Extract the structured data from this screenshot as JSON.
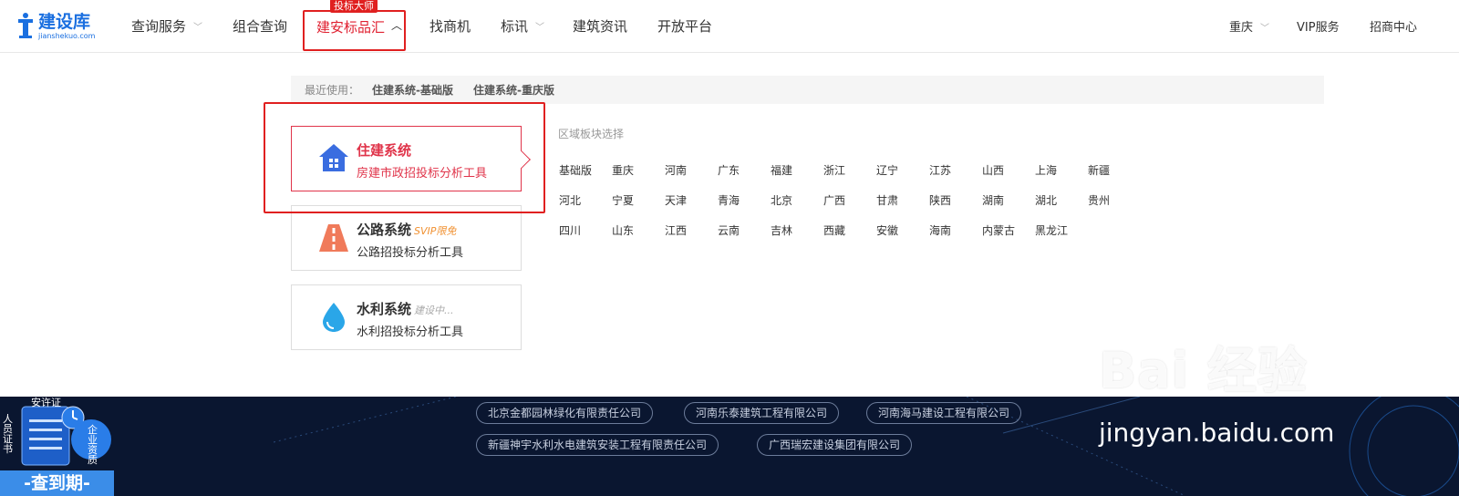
{
  "nav": {
    "logo_name": "建设库",
    "logo_sub": "jianshekuo.com",
    "items": [
      "查询服务",
      "组合查询",
      "建安标品汇",
      "找商机",
      "标讯",
      "建筑资讯",
      "开放平台"
    ],
    "badge": "投标大师",
    "right": [
      "重庆",
      "VIP服务",
      "招商中心"
    ]
  },
  "recent": {
    "label": "最近使用：",
    "items": [
      "住建系统-基础版",
      "住建系统-重庆版"
    ]
  },
  "systems": [
    {
      "title": "住建系统",
      "tag": "",
      "sub": "房建市政招投标分析工具"
    },
    {
      "title": "公路系统",
      "tag": "SVIP限免",
      "sub": "公路招投标分析工具"
    },
    {
      "title": "水利系统",
      "tag": "建设中...",
      "sub": "水利招投标分析工具"
    }
  ],
  "region_title": "区域板块选择",
  "regions": [
    [
      "基础版",
      "重庆",
      "河南",
      "广东",
      "福建",
      "浙江",
      "辽宁",
      "江苏",
      "山西",
      "上海",
      "新疆"
    ],
    [
      "河北",
      "宁夏",
      "天津",
      "青海",
      "北京",
      "广西",
      "甘肃",
      "陕西",
      "湖南",
      "湖北",
      "贵州"
    ],
    [
      "四川",
      "山东",
      "江西",
      "云南",
      "吉林",
      "西藏",
      "安徽",
      "海南",
      "内蒙古",
      "黑龙江"
    ]
  ],
  "companies": [
    [
      "北京金都园林绿化有限责任公司",
      "河南乐泰建筑工程有限公司",
      "河南海马建设工程有限公司"
    ],
    [
      "新疆神宇水利水电建筑安装工程有限责任公司",
      "广西瑞宏建设集团有限公司"
    ]
  ],
  "cert": {
    "top": "安许证",
    "left": "人员证书",
    "right": "企业资质",
    "bottom": "-查到期-"
  },
  "watermark": {
    "big": "Bai  经验",
    "url": "jingyan.baidu.com"
  },
  "colors": {
    "brand_blue": "#1a6fe0",
    "active_red": "#e0344a",
    "annotation_red": "#e02020",
    "footer_bg": "#0a1630"
  }
}
